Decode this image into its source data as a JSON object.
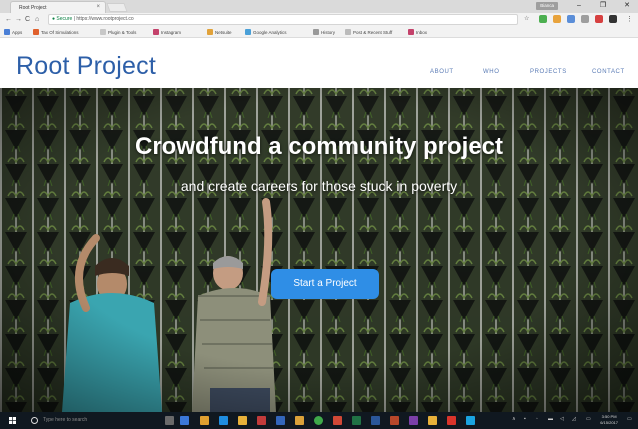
{
  "browser": {
    "tab_title": "Root Project",
    "tab_close": "×",
    "user_badge": "Bianca",
    "window_controls": {
      "minimize": "–",
      "maximize": "❐",
      "close": "✕"
    },
    "nav": {
      "back": "←",
      "forward": "→",
      "reload": "C",
      "home": "⌂"
    },
    "secure_label": "Secure",
    "url": "https://www.rootproject.co",
    "bookmarks": [
      "Apps",
      "Tax Of Simulations",
      "Plugin & Tools",
      "Instagram",
      "Netsuite",
      "Google Analytics",
      "History",
      "Post & Recent Stuff",
      "Inbox"
    ]
  },
  "site": {
    "logo": "Root Project",
    "nav": [
      "ABOUT",
      "WHO",
      "PROJECTS",
      "CONTACT"
    ],
    "hero": {
      "title": "Crowdfund a community project",
      "subtitle": "and create careers for those stuck in poverty",
      "cta": "Start a Project"
    }
  },
  "taskbar": {
    "search_placeholder": "Type here to search",
    "tray_arrows": "∧",
    "time": "3:50 PM",
    "date": "6/15/2017"
  },
  "colors": {
    "brand_blue": "#2d5fa8",
    "cta_blue": "#2f8ee6",
    "taskbar": "#101820"
  },
  "icons": [
    "search-icon",
    "windows-start-icon",
    "back-arrow-icon",
    "forward-arrow-icon",
    "reload-icon",
    "home-icon",
    "star-icon"
  ]
}
